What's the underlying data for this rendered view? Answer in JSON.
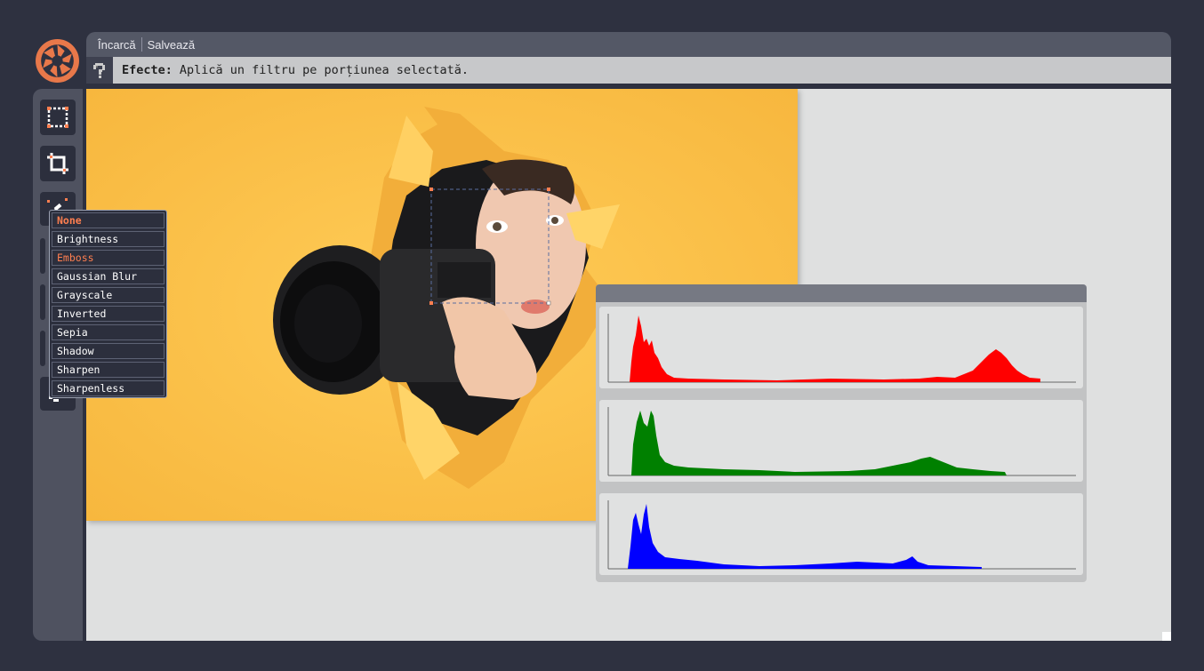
{
  "app": {
    "logo_icon": "aperture-logo-icon",
    "accent_color": "#ff7f50"
  },
  "menu": {
    "load_label": "Încarcă",
    "save_label": "Salvează"
  },
  "info": {
    "icon": "help-question-icon",
    "title": "Efecte:",
    "text": "Aplică un filtru pe porțiunea selectată."
  },
  "tools": [
    {
      "name": "select-tool",
      "icon": "selection-marquee-icon"
    },
    {
      "name": "crop-tool",
      "icon": "crop-icon"
    },
    {
      "name": "effects-tool",
      "icon": "magic-wand-icon",
      "active": true
    },
    {
      "name": "tool-4",
      "icon": "tool-icon"
    },
    {
      "name": "tool-5",
      "icon": "tool-icon"
    },
    {
      "name": "tool-6",
      "icon": "tool-icon"
    },
    {
      "name": "tool-7",
      "icon": "tool-icon"
    }
  ],
  "effects_menu": {
    "selected": "None",
    "highlighted": "Emboss",
    "options": [
      "None",
      "Brightness",
      "Emboss",
      "Gaussian Blur",
      "Grayscale",
      "Inverted",
      "Sepia",
      "Shadow",
      "Sharpen",
      "Sharpenless"
    ]
  },
  "histogram": {
    "channels": [
      {
        "name": "red",
        "color": "#ff0000"
      },
      {
        "name": "green",
        "color": "#008000"
      },
      {
        "name": "blue",
        "color": "#0000ff"
      }
    ]
  }
}
